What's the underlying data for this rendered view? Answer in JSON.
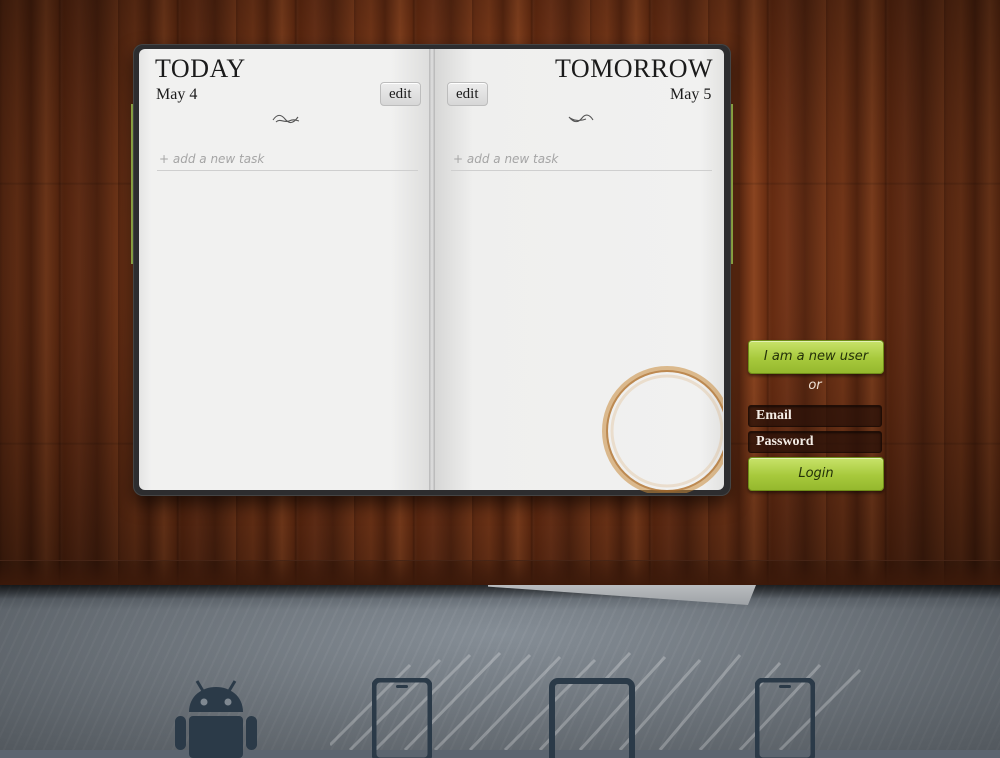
{
  "left_page": {
    "title": "TODAY",
    "date": "May 4",
    "edit_label": "edit",
    "task_placeholder": "+ add a new task"
  },
  "right_page": {
    "title": "TOMORROW",
    "date": "May 5",
    "edit_label": "edit",
    "task_placeholder": "+ add a new task"
  },
  "login": {
    "new_user_label": "I am a new user",
    "or_label": "or",
    "email_placeholder": "Email",
    "password_placeholder": "Password",
    "login_label": "Login"
  },
  "platforms": [
    {
      "icon": "android-icon"
    },
    {
      "icon": "phone-icon"
    },
    {
      "icon": "tablet-icon"
    },
    {
      "icon": "phone-icon"
    }
  ],
  "colors": {
    "accent_green": "#a7c93c",
    "wood": "#6b3015",
    "page": "#efefee"
  }
}
